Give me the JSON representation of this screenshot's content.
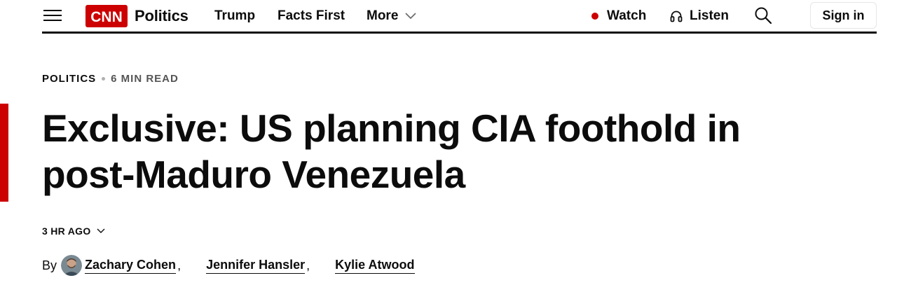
{
  "header": {
    "logo_text": "CNN",
    "section_label": "Politics",
    "nav": {
      "trump": "Trump",
      "facts_first": "Facts First",
      "more": "More"
    },
    "watch_label": "Watch",
    "listen_label": "Listen",
    "sign_in_label": "Sign in"
  },
  "icons": {
    "menu": "hamburger-menu-icon",
    "more": "chevron-down-icon",
    "live": "live-dot-icon",
    "listen": "headphones-icon",
    "search": "search-icon",
    "timestamp": "chevron-down-icon"
  },
  "colors": {
    "brand_red": "#cc0000",
    "text": "#0c0c0c",
    "muted": "#555555"
  },
  "article": {
    "section": "POLITICS",
    "read_time": "6 MIN READ",
    "headline": "Exclusive: US planning CIA foothold in post-Maduro Venezuela",
    "timestamp": "3 HR AGO",
    "byline": {
      "prefix": "By",
      "authors": [
        "Zachary Cohen",
        "Jennifer Hansler",
        "Kylie Atwood"
      ]
    }
  }
}
